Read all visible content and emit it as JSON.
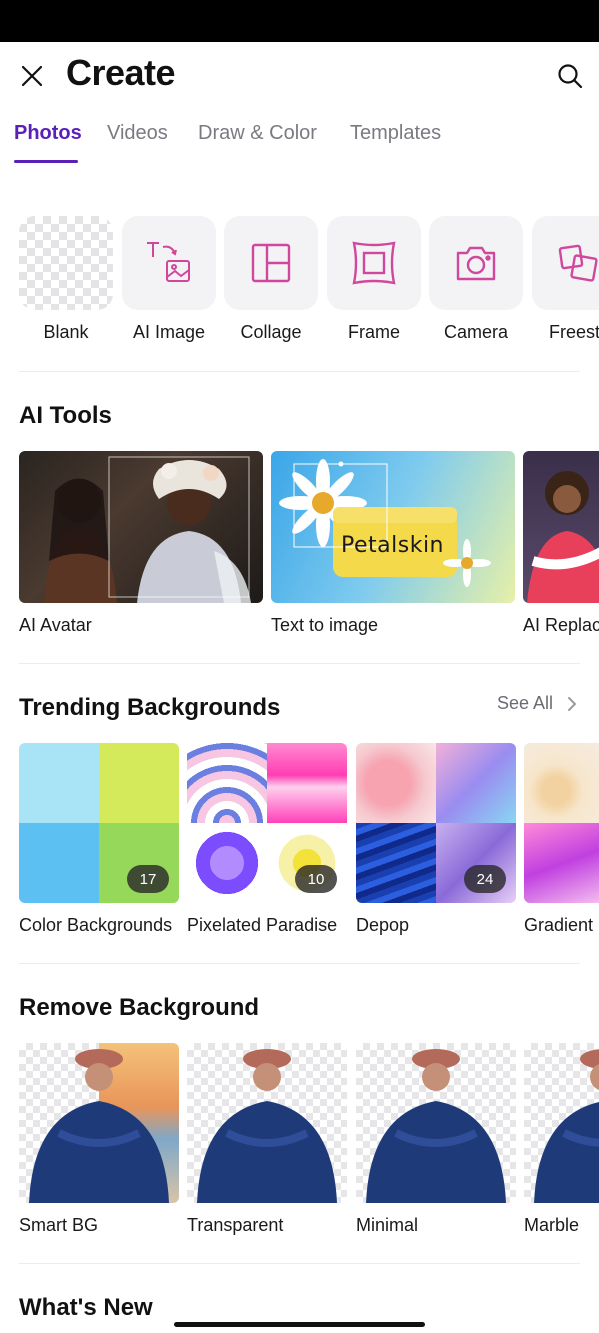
{
  "header": {
    "title": "Create",
    "close_icon": "close-icon",
    "search_icon": "search-icon"
  },
  "tabs": [
    {
      "label": "Photos",
      "active": true
    },
    {
      "label": "Videos",
      "active": false
    },
    {
      "label": "Draw & Color",
      "active": false
    },
    {
      "label": "Templates",
      "active": false
    }
  ],
  "create_items": [
    {
      "label": "Blank",
      "icon": "transparent-grid-icon"
    },
    {
      "label": "AI Image",
      "icon": "text-to-image-icon"
    },
    {
      "label": "Collage",
      "icon": "collage-layout-icon"
    },
    {
      "label": "Frame",
      "icon": "frame-icon"
    },
    {
      "label": "Camera",
      "icon": "camera-icon"
    },
    {
      "label": "Freesty",
      "icon": "freestyle-icon"
    }
  ],
  "ai_tools": {
    "title": "AI Tools",
    "items": [
      {
        "label": "AI Avatar"
      },
      {
        "label": "Text to image",
        "brand_text": "Petalskin"
      },
      {
        "label": "AI Replac"
      }
    ]
  },
  "trending": {
    "title": "Trending Backgrounds",
    "see_all": "See All",
    "items": [
      {
        "label": "Color Backgrounds",
        "count": "17"
      },
      {
        "label": "Pixelated Paradise",
        "count": "10"
      },
      {
        "label": "Depop",
        "count": "24"
      },
      {
        "label": "Gradient"
      }
    ]
  },
  "remove_bg": {
    "title": "Remove Background",
    "items": [
      {
        "label": "Smart BG"
      },
      {
        "label": "Transparent"
      },
      {
        "label": "Minimal"
      },
      {
        "label": "Marble"
      }
    ]
  },
  "whats_new": {
    "title": "What's New"
  },
  "colors": {
    "accent": "#5b21b6",
    "icon_pink": "#d0479e",
    "tile_bg": "#f3f3f5"
  }
}
